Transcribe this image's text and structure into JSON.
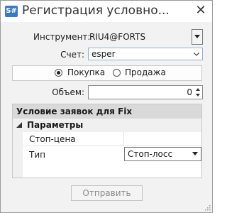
{
  "window": {
    "app_icon_text": "S#",
    "title": "Регистрация условно",
    "close_glyph": "✕"
  },
  "form": {
    "instrument_label": "Инструмент:",
    "instrument_value": "RIU4@FORTS",
    "account_label": "Счет:",
    "account_value": "esper",
    "side_options": [
      {
        "label": "Покупка",
        "checked": true
      },
      {
        "label": "Продажа",
        "checked": false
      }
    ],
    "volume_label": "Объем:",
    "volume_value": "0"
  },
  "conditions": {
    "header": "Условие заявок для Fix",
    "category": "Параметры",
    "properties": [
      {
        "name": "Стоп-цена",
        "value": ""
      },
      {
        "name": "Тип",
        "value": "Стоп-лосс"
      }
    ]
  },
  "actions": {
    "submit_label": "Отправить",
    "submit_enabled": false
  },
  "icons": {
    "close": "close-icon",
    "dropdown": "chevron-down-icon",
    "spin_up": "spin-up-icon",
    "spin_down": "spin-down-icon",
    "collapse": "collapse-triangle-icon",
    "resize_grip": "resize-grip-icon"
  },
  "colors": {
    "accent": "#3a78c8",
    "focus_border": "#8fb0d8",
    "grid_header": "#d9d9d9"
  }
}
